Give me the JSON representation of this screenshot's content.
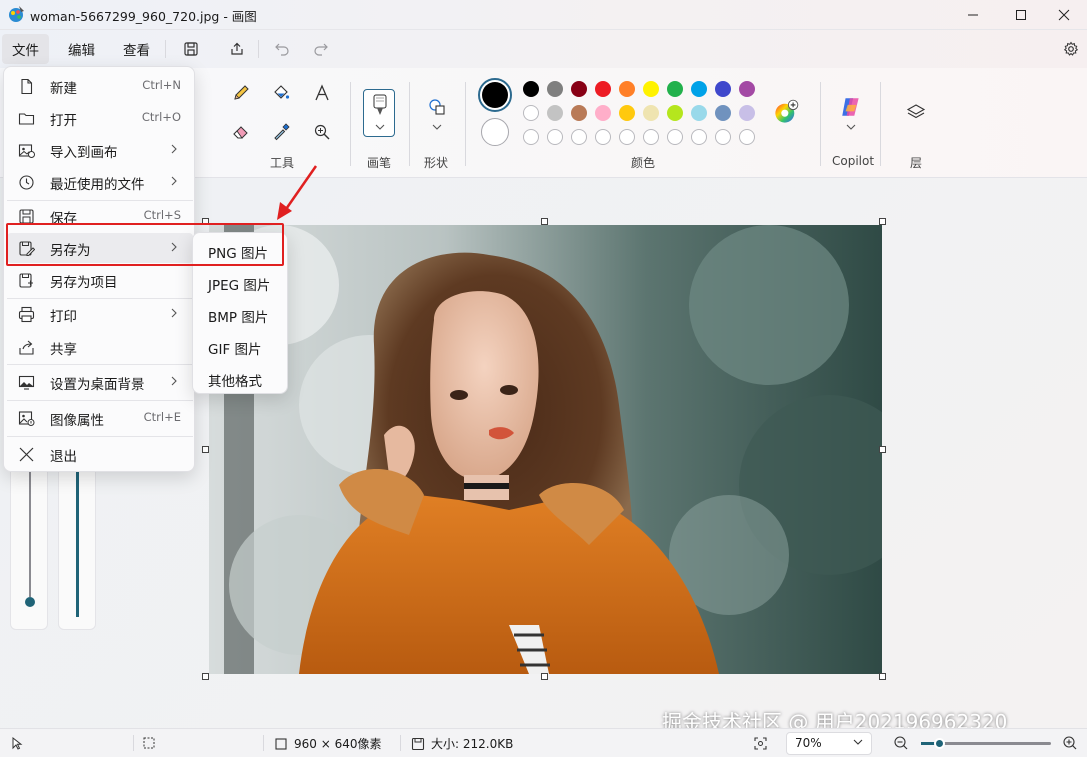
{
  "window": {
    "title": "woman-5667299_960_720.jpg - 画图"
  },
  "menubar": {
    "file": "文件",
    "edit": "编辑",
    "view": "查看"
  },
  "ribbon": {
    "tools_label": "工具",
    "brushes_label": "画笔",
    "shapes_label": "形状",
    "colors_label": "颜色",
    "copilot_label": "Copilot",
    "layers_label": "层",
    "primary_color": "#000000",
    "secondary_color": "#ffffff",
    "palette_row1": [
      "#000000",
      "#7f7f7f",
      "#880015",
      "#ed1c24",
      "#ff7f27",
      "#fff200",
      "#22b14c",
      "#00a2e8",
      "#3f48cc",
      "#a349a4"
    ],
    "palette_row2": [
      "#ffffff",
      "#c3c3c3",
      "#b97a57",
      "#ffaec9",
      "#ffc90e",
      "#efe4b0",
      "#b5e61d",
      "#99d9ea",
      "#7092be",
      "#c8bfe7"
    ]
  },
  "file_menu": {
    "items": [
      {
        "label": "新建",
        "shortcut": "Ctrl+N",
        "icon": "new-file-icon"
      },
      {
        "label": "打开",
        "shortcut": "Ctrl+O",
        "icon": "folder-icon"
      },
      {
        "label": "导入到画布",
        "shortcut": "",
        "icon": "import-image-icon"
      },
      {
        "label": "最近使用的文件",
        "shortcut": "",
        "icon": "clock-icon"
      },
      {
        "label": "保存",
        "shortcut": "Ctrl+S",
        "icon": "save-icon"
      },
      {
        "label": "另存为",
        "shortcut": "",
        "icon": "save-as-icon"
      },
      {
        "label": "另存为项目",
        "shortcut": "",
        "icon": "save-project-icon"
      },
      {
        "label": "打印",
        "shortcut": "",
        "icon": "printer-icon"
      },
      {
        "label": "共享",
        "shortcut": "",
        "icon": "share-icon"
      },
      {
        "label": "设置为桌面背景",
        "shortcut": "",
        "icon": "desktop-background-icon"
      },
      {
        "label": "图像属性",
        "shortcut": "Ctrl+E",
        "icon": "image-properties-icon"
      },
      {
        "label": "退出",
        "shortcut": "",
        "icon": "close-icon"
      }
    ]
  },
  "save_as_submenu": {
    "items": [
      "PNG 图片",
      "JPEG 图片",
      "BMP 图片",
      "GIF 图片",
      "其他格式"
    ]
  },
  "status": {
    "dimensions": "960 × 640像素",
    "size": "大小: 212.0KB",
    "zoom": "70%"
  },
  "watermark": "掘金技术社区 @ 用户2021969623​20"
}
